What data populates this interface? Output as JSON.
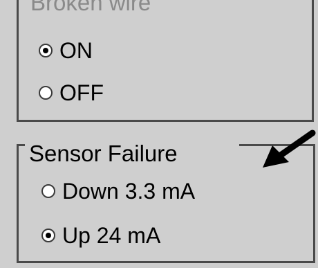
{
  "broken_wire": {
    "legend": "Broken wire",
    "options": [
      {
        "label": "ON",
        "selected": true
      },
      {
        "label": "OFF",
        "selected": false
      }
    ]
  },
  "sensor_failure": {
    "legend": "Sensor Failure",
    "options": [
      {
        "label": "Down 3.3 mA",
        "selected": false
      },
      {
        "label": "Up 24 mA",
        "selected": true
      }
    ]
  },
  "annotation": {
    "icon": "arrow-icon",
    "color": "#000000"
  },
  "colors": {
    "panel_background": "#cfcfcf",
    "border": "#4a4a4a",
    "disabled_text": "#8a8a8a"
  }
}
